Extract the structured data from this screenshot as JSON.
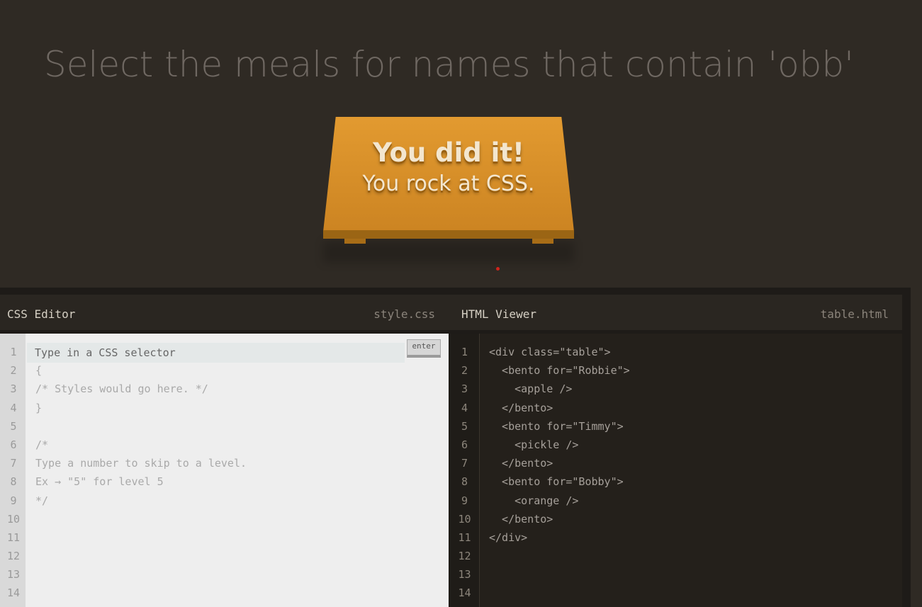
{
  "level": {
    "instruction": "Select the meals for names that contain 'obb'"
  },
  "win_message": {
    "line1": "You did it!",
    "line2": "You rock at CSS."
  },
  "css_editor": {
    "title": "CSS Editor",
    "filename": "style.css",
    "input_placeholder": "Type in a CSS selector",
    "enter_label": "enter",
    "line_numbers": [
      "1",
      "2",
      "3",
      "4",
      "5",
      "6",
      "7",
      "8",
      "9",
      "10",
      "11",
      "12",
      "13",
      "14"
    ],
    "lines": [
      "",
      "{",
      "/* Styles would go here. */",
      "}",
      "",
      "/*",
      "Type a number to skip to a level.",
      "Ex → \"5\" for level 5",
      "*/",
      "",
      "",
      "",
      "",
      ""
    ]
  },
  "html_viewer": {
    "title": "HTML Viewer",
    "filename": "table.html",
    "line_numbers": [
      "1",
      "2",
      "3",
      "4",
      "5",
      "6",
      "7",
      "8",
      "9",
      "10",
      "11",
      "12",
      "13",
      "14"
    ],
    "lines": [
      "<div class=\"table\">",
      "  <bento for=\"Robbie\">",
      "    <apple />",
      "  </bento>",
      "  <bento for=\"Timmy\">",
      "    <pickle />",
      "  </bento>",
      "  <bento for=\"Bobby\">",
      "    <orange />",
      "  </bento>",
      "</div>",
      "",
      "",
      ""
    ]
  },
  "colors": {
    "background": "#2f2a24",
    "table": "#e29a30",
    "cursor_dot": "#d0241c"
  }
}
